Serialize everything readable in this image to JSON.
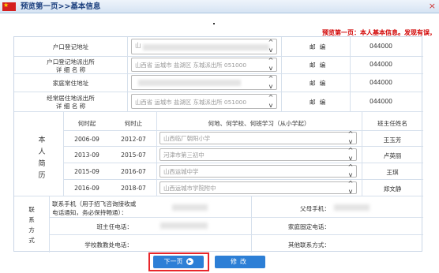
{
  "header": {
    "title": "预览第一页>>基本信息",
    "close": "×"
  },
  "notice": "预览第一页：本人基本信息。发现有误，",
  "addresses": [
    {
      "label": "户口登记地址",
      "value": "山",
      "mail_label": "邮编",
      "postcode": "044000"
    },
    {
      "label1": "户口登记地派出所",
      "label2": "详 细 名 称",
      "value": "山西省 运城市 盐湖区 东城派出所 051000",
      "mail_label": "邮编",
      "postcode": "044000"
    },
    {
      "label": "家庭常住地址",
      "value": "",
      "mail_label": "邮编",
      "postcode": "044000"
    },
    {
      "label1": "经常居住地派出所",
      "label2": "详 细 名 称",
      "value": "山西省 运城市 盐湖区 东城派出所 051000",
      "mail_label": "邮编",
      "postcode": "044000"
    }
  ],
  "resume": {
    "section_title": "本人简历",
    "headers": {
      "start": "何时起",
      "end": "何时止",
      "place": "何地、何学校、何班学习（从小学起）",
      "teacher": "班主任姓名"
    },
    "rows": [
      {
        "start": "2006-09",
        "end": "2012-07",
        "place": "山西临厂朝阳小学",
        "teacher": "王玉芳"
      },
      {
        "start": "2013-09",
        "end": "2015-07",
        "place": "河津市第三初中",
        "teacher": "卢英丽"
      },
      {
        "start": "2015-09",
        "end": "2016-07",
        "place": "山西运城中学",
        "teacher": "王琪"
      },
      {
        "start": "2016-09",
        "end": "2018-07",
        "place": "山西运城市学院附中",
        "teacher": "郑文静"
      }
    ]
  },
  "contact": {
    "section_title": "联系方式",
    "phone_label_1": "联系手机（用于招飞咨询接收或",
    "phone_label_2": "电话通知，务必保持畅通）：",
    "father_label": "父母手机：",
    "teacher_phone_label": "班主任电话：",
    "home_phone_label": "家庭固定电话：",
    "school_phone_label": "学校教教处电话：",
    "other_label": "其他联系方式："
  },
  "buttons": {
    "next": "下一页",
    "next_icon": "▶",
    "edit": "修改"
  },
  "colors": {
    "accent": "#2d7fd6",
    "title": "#1b3f7e",
    "notice": "#d10000",
    "highlight": "#e8262b"
  }
}
